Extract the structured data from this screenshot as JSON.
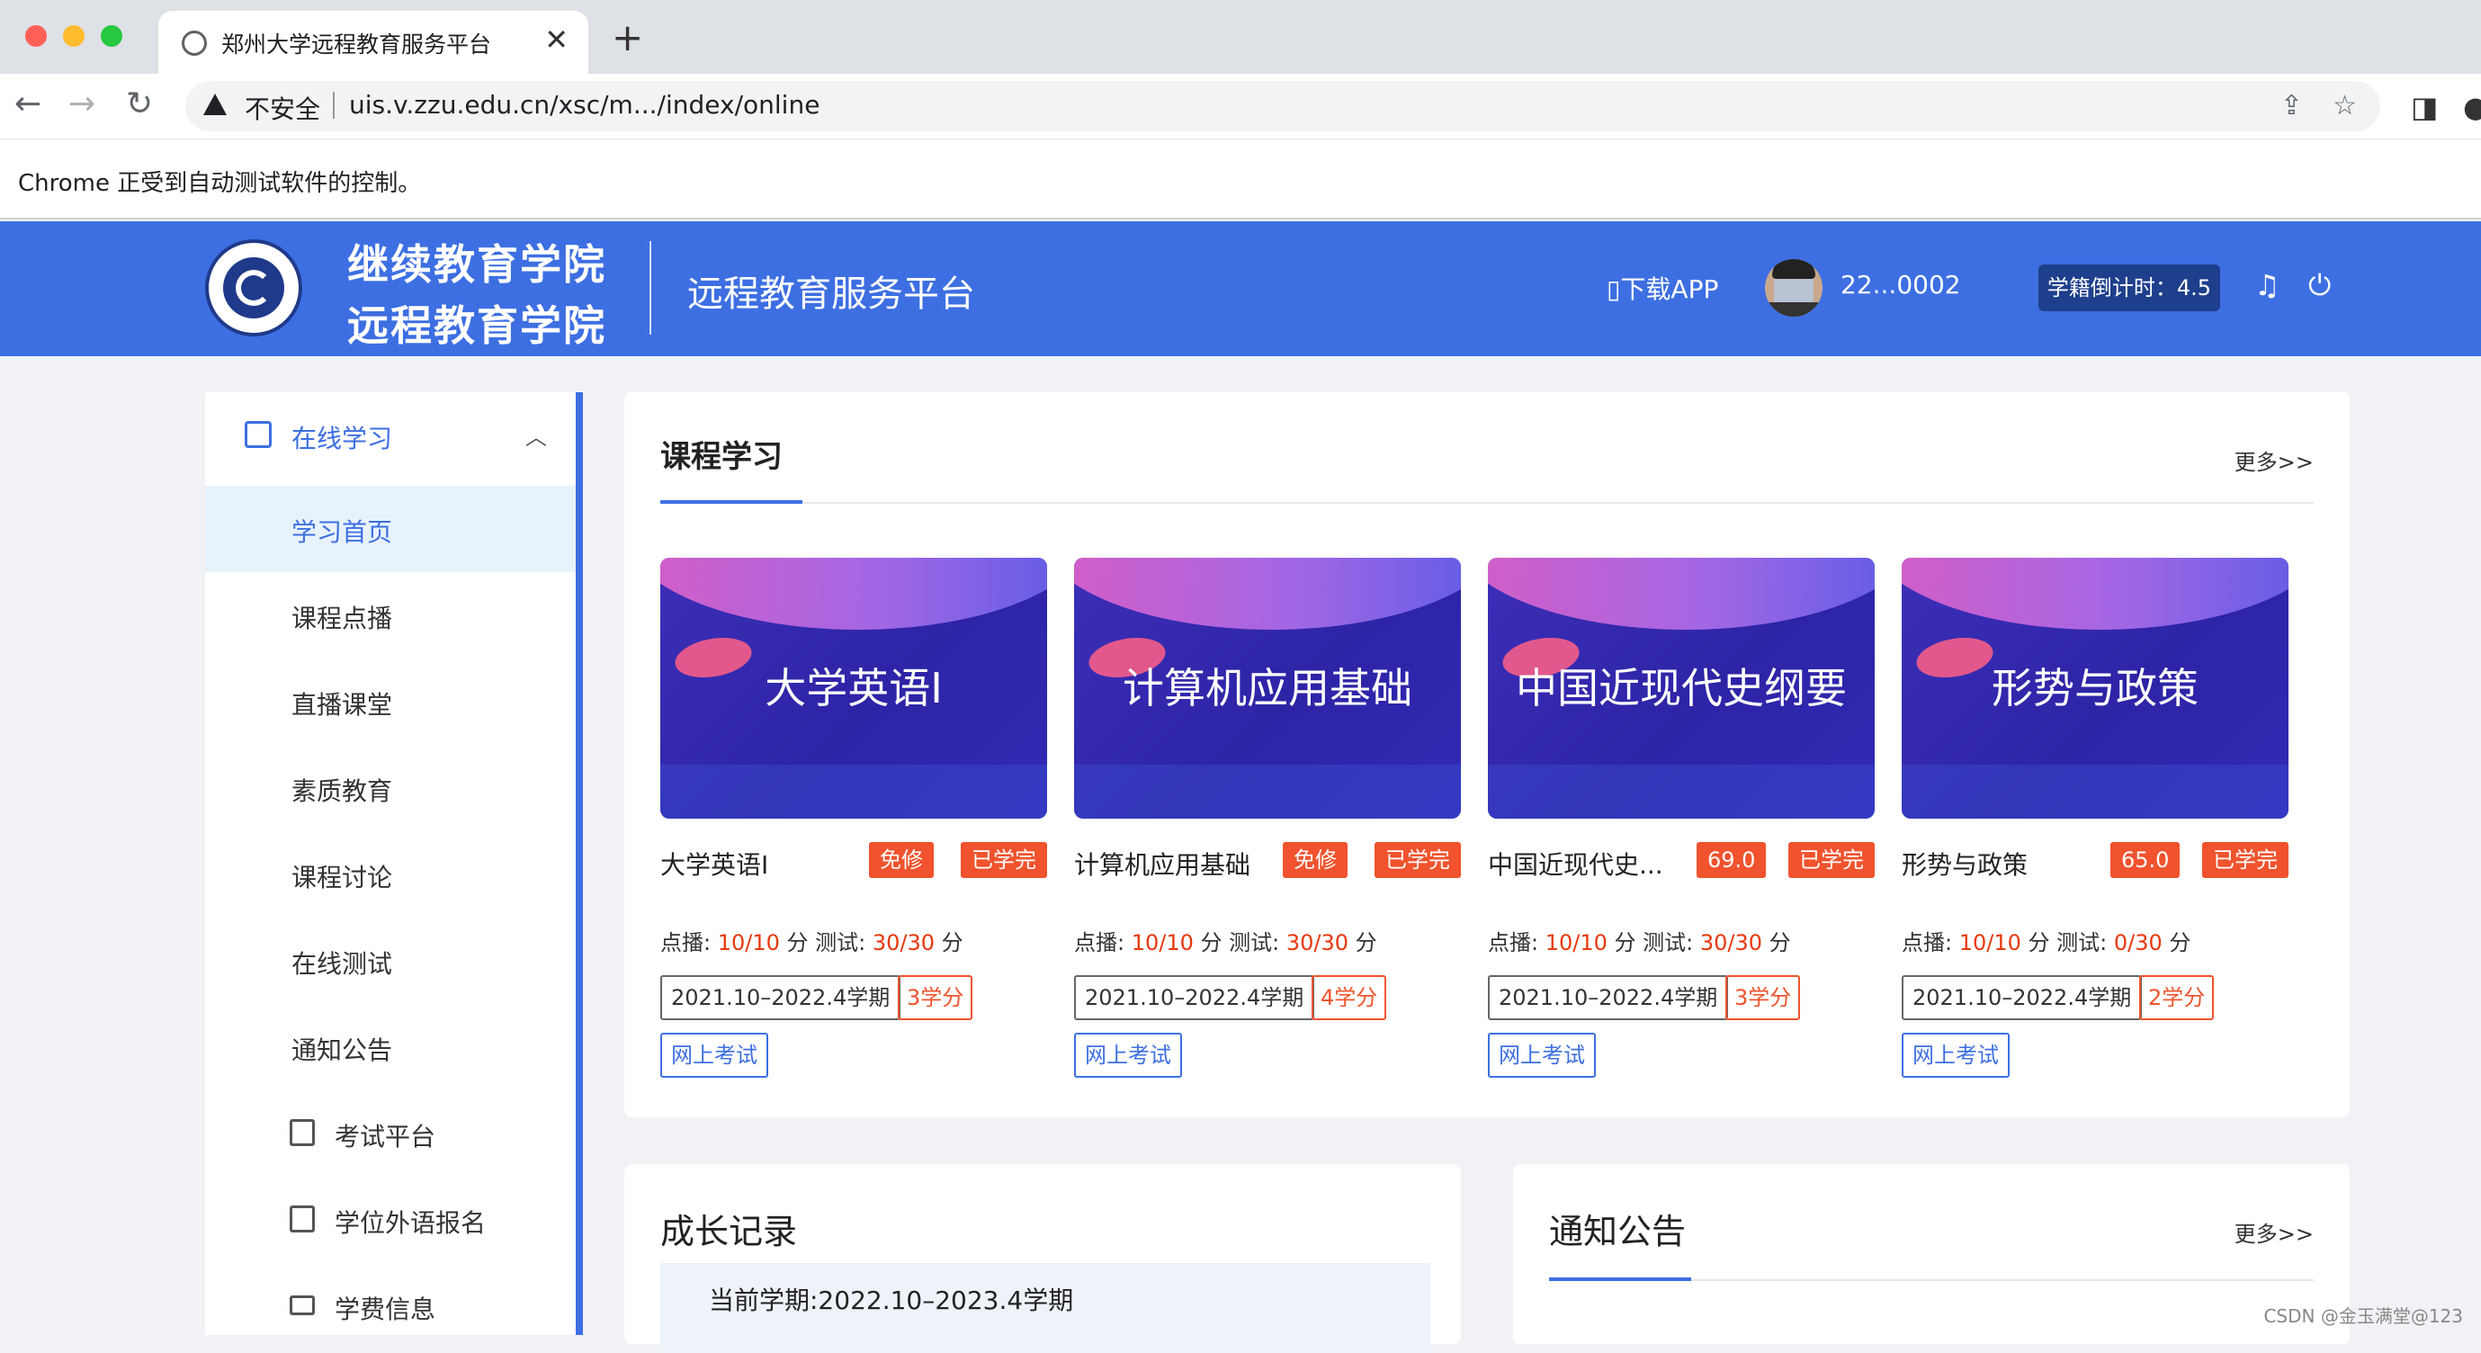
{
  "browser": {
    "tab_title": "郑州大学远程教育服务平台",
    "tab_close": "✕",
    "new_tab": "+",
    "insecure_label": "不安全",
    "url": "uis.v.zzu.edu.cn/xsc/m.../index/online",
    "automation_notice": "Chrome 正受到自动测试软件的控制。"
  },
  "header": {
    "school_name_line1": "继续教育学院",
    "school_name_line2": "远程教育学院",
    "platform_name": "远程教育服务平台",
    "download_app": "▯下载APP",
    "user_id": "22...0002",
    "countdown": "学籍倒计时：4.5"
  },
  "sidebar": {
    "parent_label": "在线学习",
    "items": [
      {
        "label": "学习首页"
      },
      {
        "label": "课程点播"
      },
      {
        "label": "直播课堂"
      },
      {
        "label": "素质教育"
      },
      {
        "label": "课程讨论"
      },
      {
        "label": "在线测试"
      },
      {
        "label": "通知公告"
      },
      {
        "label": "考试平台"
      },
      {
        "label": "学位外语报名"
      },
      {
        "label": "学费信息"
      }
    ]
  },
  "course_section": {
    "title": "课程学习",
    "more": "更多>>",
    "courses": [
      {
        "cover_title": "大学英语I",
        "name": "大学英语I",
        "badge1": "免修",
        "badge2": "已学完",
        "stats_prefix": "点播: ",
        "vod": "10/10",
        "mid": " 分  测试: ",
        "test": "30/30",
        "suffix": " 分",
        "term": "2021.10–2022.4学期",
        "credits": "3学分",
        "exam": "网上考试"
      },
      {
        "cover_title": "计算机应用基础",
        "name": "计算机应用基础",
        "badge1": "免修",
        "badge2": "已学完",
        "stats_prefix": "点播: ",
        "vod": "10/10",
        "mid": " 分  测试: ",
        "test": "30/30",
        "suffix": " 分",
        "term": "2021.10–2022.4学期",
        "credits": "4学分",
        "exam": "网上考试"
      },
      {
        "cover_title": "中国近现代史纲要",
        "name": "中国近现代史...",
        "badge1": "69.0",
        "badge2": "已学完",
        "stats_prefix": "点播: ",
        "vod": "10/10",
        "mid": " 分  测试: ",
        "test": "30/30",
        "suffix": " 分",
        "term": "2021.10–2022.4学期",
        "credits": "3学分",
        "exam": "网上考试"
      },
      {
        "cover_title": "形势与政策",
        "name": "形势与政策",
        "badge1": "65.0",
        "badge2": "已学完",
        "stats_prefix": "点播: ",
        "vod": "10/10",
        "mid": " 分  测试: ",
        "test": "0/30",
        "suffix": " 分",
        "term": "2021.10–2022.4学期",
        "credits": "2学分",
        "exam": "网上考试"
      }
    ]
  },
  "growth": {
    "title": "成长记录",
    "current_term": "当前学期:2022.10–2023.4学期"
  },
  "notices": {
    "title": "通知公告",
    "more": "更多>>"
  },
  "watermark": "CSDN @金玉满堂@123",
  "colors": {
    "brand": "#3d6fe2",
    "badge": "#f0532d",
    "highlight": "#e8380d"
  }
}
